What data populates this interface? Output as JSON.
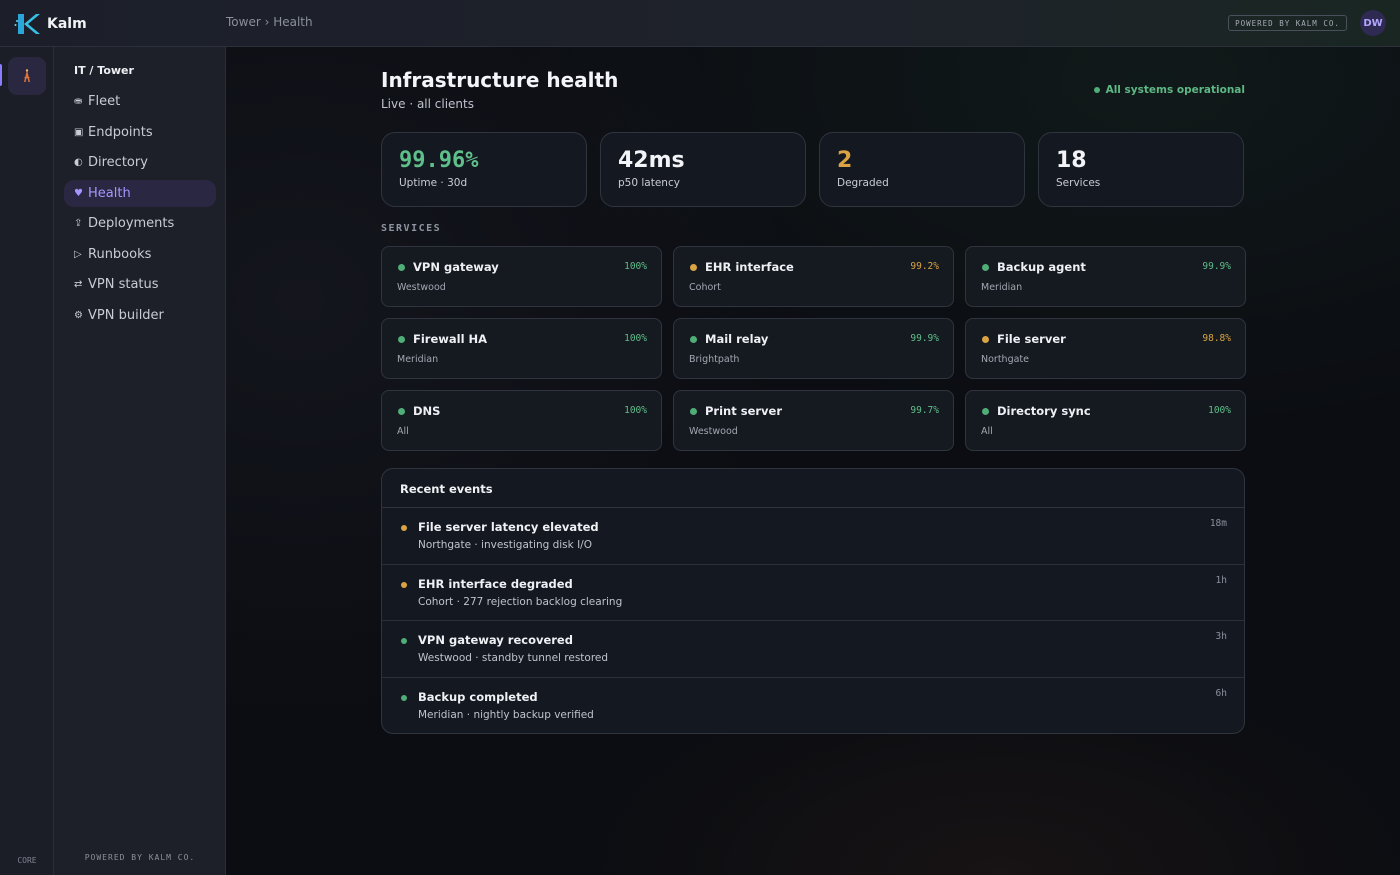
{
  "app": {
    "name": "Kalm",
    "breadcrumb": "Tower › Health",
    "powered_label": "POWERED BY KALM CO.",
    "user_initials": "DW"
  },
  "rail": {
    "footer": "CORE"
  },
  "sidebar": {
    "heading": "IT / Tower",
    "items": [
      {
        "icon": "⛂",
        "label": "Fleet",
        "active": false
      },
      {
        "icon": "▣",
        "label": "Endpoints",
        "active": false
      },
      {
        "icon": "◐",
        "label": "Directory",
        "active": false
      },
      {
        "icon": "♥",
        "label": "Health",
        "active": true
      },
      {
        "icon": "⇪",
        "label": "Deployments",
        "active": false
      },
      {
        "icon": "▷",
        "label": "Runbooks",
        "active": false
      },
      {
        "icon": "⇄",
        "label": "VPN status",
        "active": false
      },
      {
        "icon": "⚙",
        "label": "VPN builder",
        "active": false
      }
    ],
    "footer": "POWERED BY KALM CO."
  },
  "page": {
    "title": "Infrastructure health",
    "subtitle": "Live · all clients",
    "status": "All systems operational"
  },
  "kpis": [
    {
      "value": "99.96%",
      "label": "Uptime · 30d",
      "color": "#5fbf8a",
      "mono": true
    },
    {
      "value": "42ms",
      "label": "p50 latency",
      "color": "#f2f3f6",
      "mono": false
    },
    {
      "value": "2",
      "label": "Degraded",
      "color": "#d9a441",
      "mono": false
    },
    {
      "value": "18",
      "label": "Services",
      "color": "#f2f3f6",
      "mono": false
    }
  ],
  "services_label": "SERVICES",
  "services": [
    {
      "name": "VPN gateway",
      "client": "Westwood",
      "uptime": "100%",
      "status": "ok"
    },
    {
      "name": "EHR interface",
      "client": "Cohort",
      "uptime": "99.2%",
      "status": "warn"
    },
    {
      "name": "Backup agent",
      "client": "Meridian",
      "uptime": "99.9%",
      "status": "ok"
    },
    {
      "name": "Firewall HA",
      "client": "Meridian",
      "uptime": "100%",
      "status": "ok"
    },
    {
      "name": "Mail relay",
      "client": "Brightpath",
      "uptime": "99.9%",
      "status": "ok"
    },
    {
      "name": "File server",
      "client": "Northgate",
      "uptime": "98.8%",
      "status": "warn"
    },
    {
      "name": "DNS",
      "client": "All",
      "uptime": "100%",
      "status": "ok"
    },
    {
      "name": "Print server",
      "client": "Westwood",
      "uptime": "99.7%",
      "status": "ok"
    },
    {
      "name": "Directory sync",
      "client": "All",
      "uptime": "100%",
      "status": "ok"
    }
  ],
  "events": {
    "heading": "Recent events",
    "items": [
      {
        "title": "File server latency elevated",
        "detail": "Northgate · investigating disk I/O",
        "time": "18m",
        "status": "warn"
      },
      {
        "title": "EHR interface degraded",
        "detail": "Cohort · 277 rejection backlog clearing",
        "time": "1h",
        "status": "warn"
      },
      {
        "title": "VPN gateway recovered",
        "detail": "Westwood · standby tunnel restored",
        "time": "3h",
        "status": "ok"
      },
      {
        "title": "Backup completed",
        "detail": "Meridian · nightly backup verified",
        "time": "6h",
        "status": "ok"
      }
    ]
  },
  "colors": {
    "ok": "#4fae77",
    "warn": "#d9a441",
    "ok_text": "#5fbf8a",
    "warn_text": "#d9a441",
    "accent": "#8b7bff"
  }
}
